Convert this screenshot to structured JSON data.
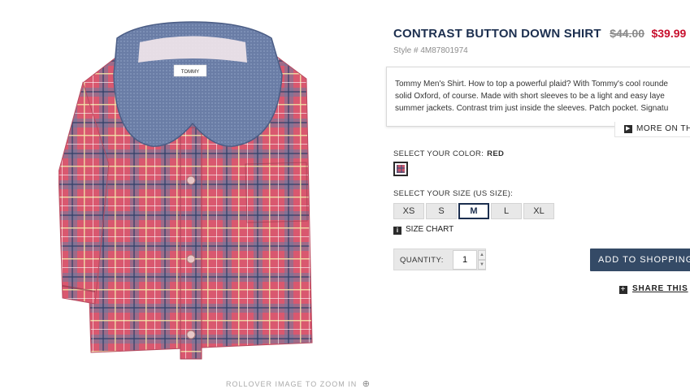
{
  "product": {
    "title": "CONTRAST BUTTON DOWN SHIRT",
    "price_old": "$44.00",
    "price_new": "$39.99",
    "style": "Style # 4M87801974",
    "collar_tag": "TOMMY",
    "description_lines": [
      "Tommy Men's Shirt. How to top a powerful plaid? With Tommy's cool rounde",
      "solid Oxford, of course. Made with short sleeves to be a light and easy laye",
      "summer jackets. Contrast trim just inside the sleeves. Patch pocket. Signatu"
    ],
    "more_info": "MORE ON TH",
    "zoom_hint": "ROLLOVER IMAGE TO ZOOM IN"
  },
  "color": {
    "label": "SELECT YOUR COLOR:",
    "value": "RED"
  },
  "size": {
    "label": "SELECT YOUR SIZE (US SIZE):",
    "options": [
      "XS",
      "S",
      "M",
      "L",
      "XL"
    ],
    "selected": "M",
    "chart_label": "SIZE CHART"
  },
  "quantity": {
    "label": "QUANTITY:",
    "value": "1"
  },
  "actions": {
    "add_to_bag": "ADD TO SHOPPING",
    "share": "SHARE THIS"
  },
  "colors": {
    "title": "#1c2f4f",
    "sale": "#c8102e",
    "button": "#344a66"
  }
}
